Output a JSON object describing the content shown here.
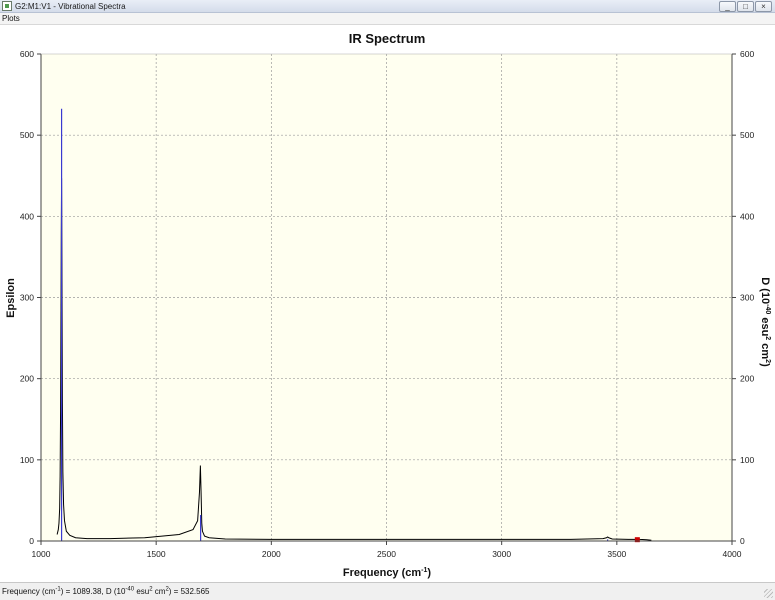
{
  "window": {
    "title": "G2:M1:V1 - Vibrational Spectra",
    "min_label": "_",
    "max_label": "□",
    "close_label": "×"
  },
  "menu": {
    "plots_label": "Plots"
  },
  "status": {
    "prefix1": "Frequency (cm",
    "sup1": "-1",
    "mid1": ") = 1089.38, D (10",
    "sup2": "-40",
    "mid2": " esu",
    "sup3": "2",
    "mid3": " cm",
    "sup4": "2",
    "suffix": ") = 532.565"
  },
  "colors": {
    "plot_bg": "#fffff0",
    "grid": "#9a9a9a",
    "curve": "#000000",
    "stick": "#3a3ad0",
    "marker": "#cc0000",
    "title_bar": "#dfe6f1"
  },
  "chart_data": {
    "type": "line",
    "title": "IR Spectrum",
    "xlabel": "Frequency (cm-1)",
    "xlabel_base": "Frequency (cm",
    "xlabel_sup": "-1",
    "xlabel_close": ")",
    "ylabel": "Epsilon",
    "y2label": "D (10-40 esu2 cm2)",
    "y2label_parts": {
      "a": "D (10",
      "b": "-40",
      "c": " esu",
      "d": "2",
      "e": " cm",
      "f": "2",
      "g": ")"
    },
    "xlim": [
      1000,
      4000
    ],
    "ylim": [
      0,
      600
    ],
    "y2lim": [
      0,
      600
    ],
    "xticks": [
      1000,
      1500,
      2000,
      2500,
      3000,
      3500,
      4000
    ],
    "yticks": [
      0,
      100,
      200,
      300,
      400,
      500,
      600
    ],
    "grid": true,
    "series": [
      {
        "kind": "curve",
        "x": [
          1070,
          1075,
          1078,
          1081,
          1083,
          1085,
          1087,
          1088,
          1089.4,
          1091,
          1093,
          1095,
          1098,
          1102,
          1110,
          1125,
          1150,
          1200,
          1300,
          1450,
          1600,
          1660,
          1680,
          1688,
          1692,
          1695,
          1698,
          1701,
          1710,
          1730,
          1800,
          2000,
          2500,
          3000,
          3300,
          3440,
          3455,
          3460,
          3465,
          3480,
          3550,
          3580,
          3587,
          3592,
          3600,
          3630,
          3650
        ],
        "y": [
          8,
          14,
          22,
          40,
          80,
          160,
          300,
          380,
          447,
          340,
          170,
          85,
          45,
          25,
          12,
          7,
          4,
          3,
          3,
          4,
          8,
          14,
          25,
          60,
          93,
          60,
          22,
          12,
          6,
          4,
          2.5,
          2,
          2,
          2,
          2,
          3,
          4,
          5,
          4,
          2.5,
          2,
          2,
          2.5,
          3,
          2,
          1.5,
          1
        ]
      },
      {
        "kind": "sticks",
        "x": [
          1089.38,
          1693,
          3460,
          3589
        ],
        "y": [
          532.565,
          32,
          2,
          1
        ]
      }
    ],
    "marker": {
      "x": 3589,
      "y": 1
    }
  }
}
